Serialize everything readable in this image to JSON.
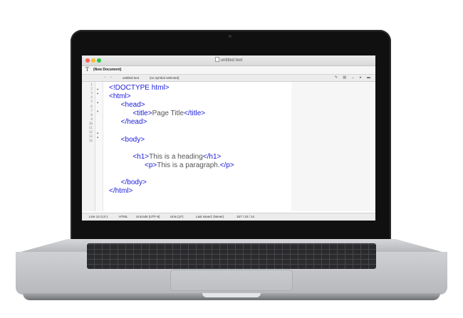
{
  "window": {
    "title": "untitled text"
  },
  "toolbar": {
    "document_label": "(New Document)",
    "tool_icon": "text-tool-icon"
  },
  "navbar": {
    "back_glyph": "‹",
    "forward_glyph": "›",
    "file_menu": "untitled text",
    "symbol_menu": "(no symbol selected)",
    "right_glyphs": "✎ ▤ ⌄ ▸ ▬"
  },
  "gutter": {
    "line_numbers": [
      "1",
      "2",
      "3",
      "4",
      "5",
      "6",
      "7",
      "8",
      "9",
      "10",
      "11",
      "12",
      "13",
      "14"
    ],
    "fold_glyphs": [
      "",
      "▾",
      "▾",
      "",
      "▴",
      "",
      "▾",
      "",
      "",
      "",
      "",
      "▴",
      "▴",
      ""
    ]
  },
  "code": [
    {
      "indent": "",
      "parts": [
        {
          "t": "tag",
          "v": "<!DOCTYPE html>"
        }
      ]
    },
    {
      "indent": "",
      "parts": [
        {
          "t": "tag",
          "v": "<html>"
        }
      ]
    },
    {
      "indent": "      ",
      "parts": [
        {
          "t": "tag",
          "v": "<head>"
        }
      ]
    },
    {
      "indent": "            ",
      "parts": [
        {
          "t": "tag",
          "v": "<title>"
        },
        {
          "t": "txt",
          "v": "Page Title"
        },
        {
          "t": "tag",
          "v": "</title>"
        }
      ]
    },
    {
      "indent": "      ",
      "parts": [
        {
          "t": "tag",
          "v": "</head>"
        }
      ]
    },
    {
      "indent": "",
      "parts": []
    },
    {
      "indent": "      ",
      "parts": [
        {
          "t": "tag",
          "v": "<body>"
        }
      ]
    },
    {
      "indent": "",
      "parts": []
    },
    {
      "indent": "            ",
      "parts": [
        {
          "t": "tag",
          "v": "<h1>"
        },
        {
          "t": "txt",
          "v": "This is a heading"
        },
        {
          "t": "tag",
          "v": "</h1>"
        }
      ]
    },
    {
      "indent": "                  ",
      "parts": [
        {
          "t": "tag",
          "v": "<p>"
        },
        {
          "t": "txt",
          "v": "This is a paragraph."
        },
        {
          "t": "tag",
          "v": "</p>"
        }
      ]
    },
    {
      "indent": "",
      "parts": []
    },
    {
      "indent": "      ",
      "parts": [
        {
          "t": "tag",
          "v": "</body>"
        }
      ]
    },
    {
      "indent": "",
      "parts": [
        {
          "t": "tag",
          "v": "</html>"
        }
      ]
    }
  ],
  "statusbar": {
    "position": "Line 14 Col 1",
    "language": "HTML",
    "encoding": "Unicode (UTF-8)",
    "line_endings": "Unix (LF)",
    "saved": "Last saved: (Never)",
    "counts": "157 / 24 / 14"
  },
  "colors": {
    "tag": "#1a1adb",
    "text": "#555555",
    "close": "#fc5f57",
    "minimize": "#fdbc2e",
    "maximize": "#28c840"
  }
}
